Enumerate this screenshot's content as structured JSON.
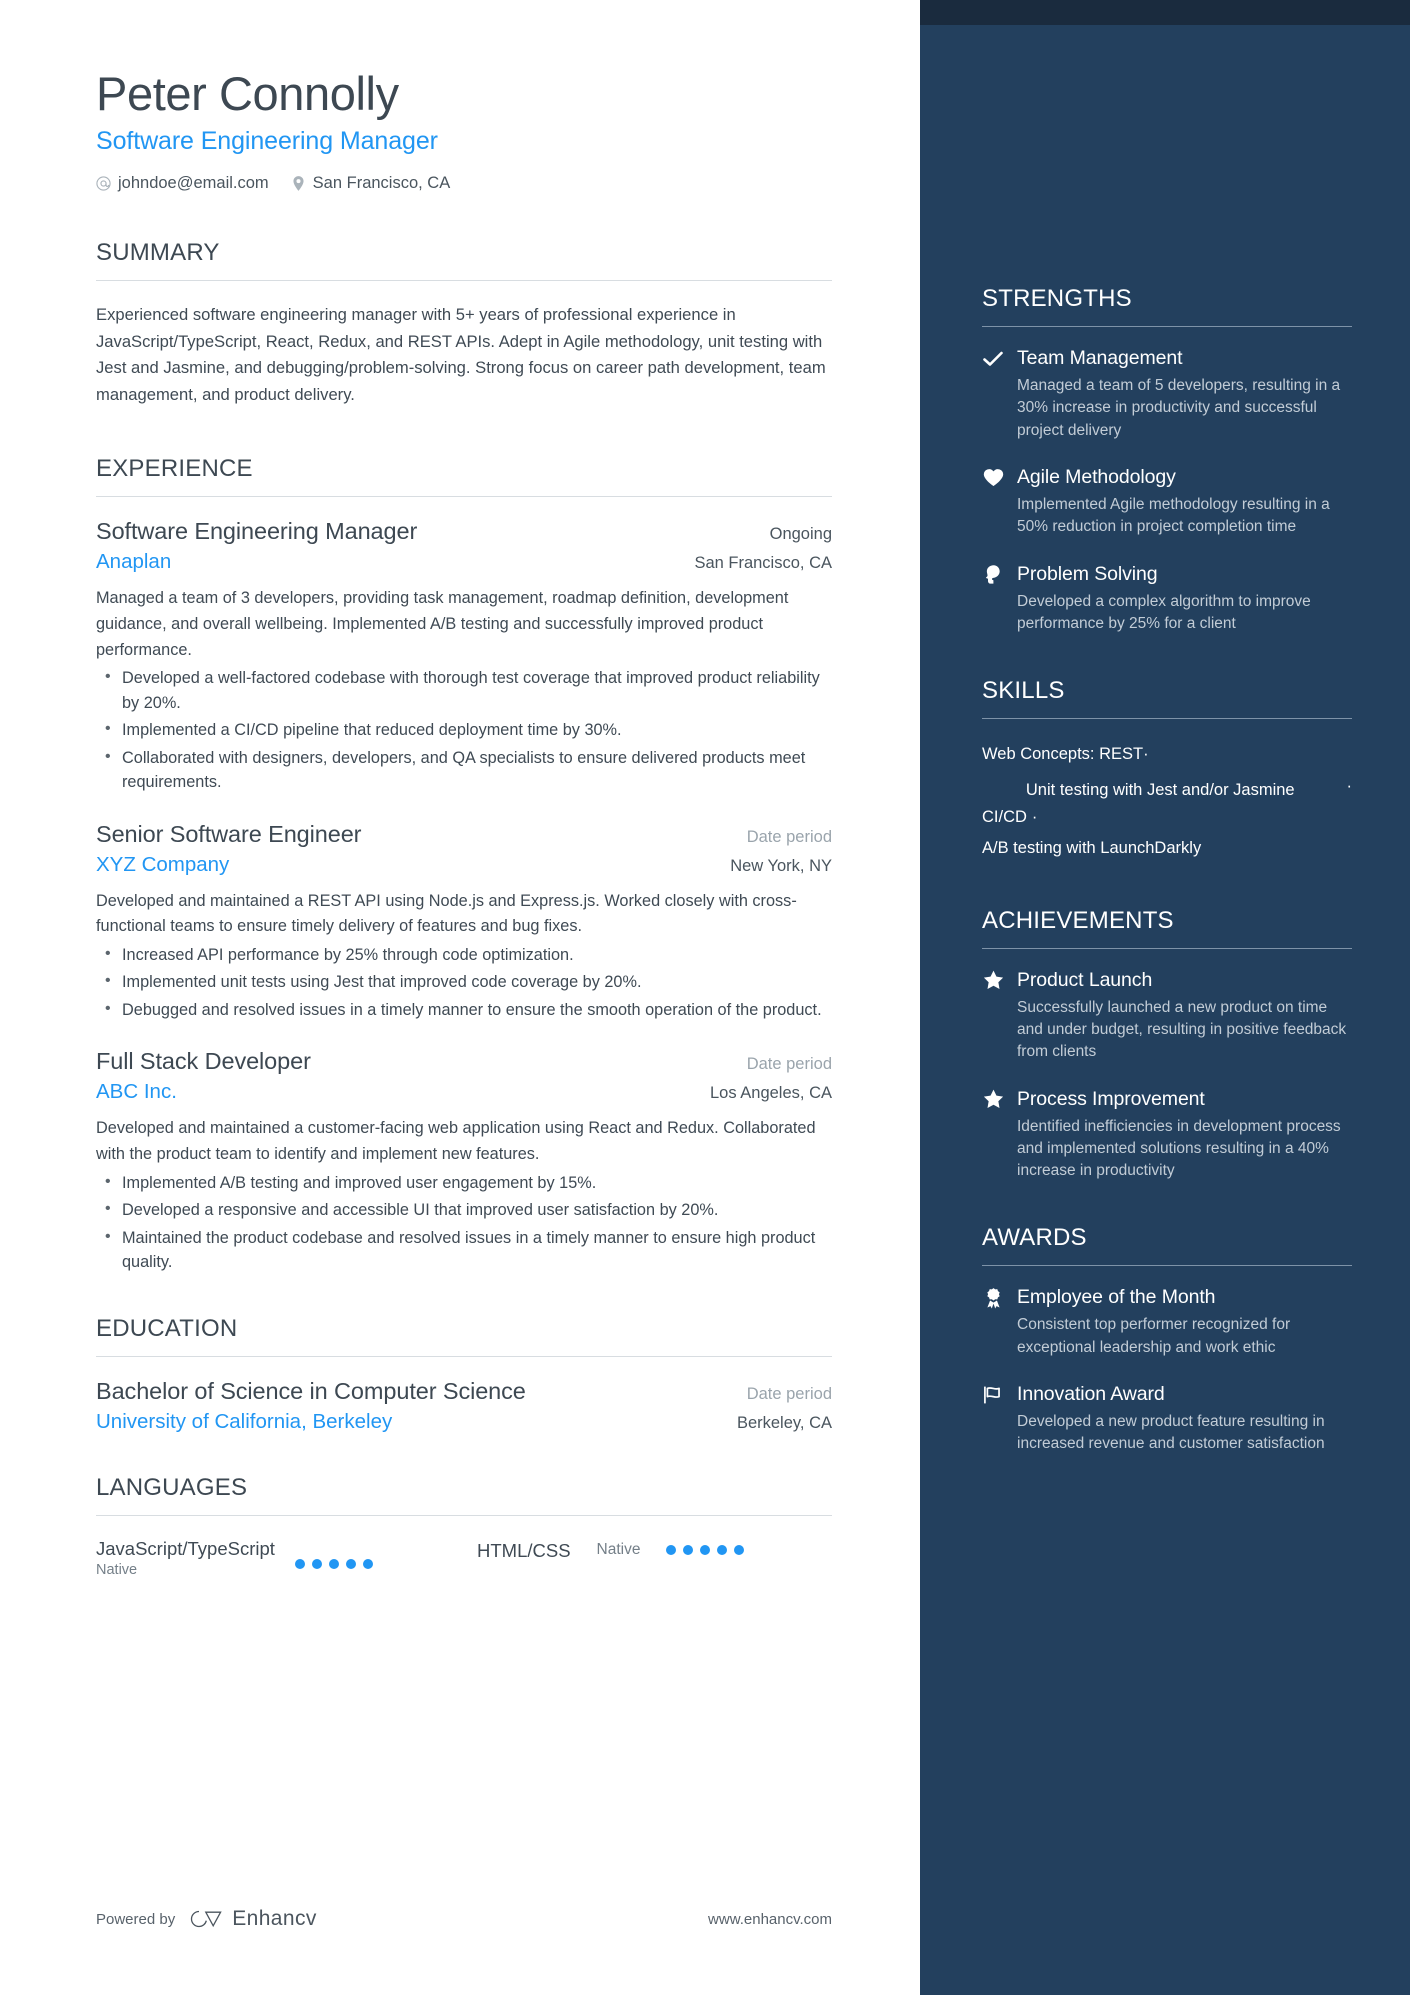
{
  "header": {
    "name": "Peter Connolly",
    "headline": "Software Engineering Manager",
    "email": "johndoe@email.com",
    "location": "San Francisco, CA"
  },
  "summary": {
    "title": "SUMMARY",
    "text": "Experienced software engineering manager with 5+ years of professional experience in JavaScript/TypeScript, React, Redux, and REST APIs. Adept in Agile methodology, unit testing with Jest and Jasmine, and debugging/problem-solving. Strong focus on career path development, team management, and product delivery."
  },
  "experience": {
    "title": "EXPERIENCE",
    "entries": [
      {
        "title": "Software Engineering Manager",
        "date": "Ongoing",
        "org": "Anaplan",
        "location": "San Francisco, CA",
        "description": "Managed a team of 3 developers, providing task management, roadmap definition, development guidance, and overall wellbeing. Implemented A/B testing and successfully improved product performance.",
        "bullets": [
          "Developed a well-factored codebase with thorough test coverage that improved product reliability by 20%.",
          "Implemented a CI/CD pipeline that reduced deployment time by 30%.",
          "Collaborated with designers, developers, and QA specialists to ensure delivered products meet requirements."
        ]
      },
      {
        "title": "Senior Software Engineer",
        "date": "Date period",
        "org": "XYZ Company",
        "location": "New York, NY",
        "description": "Developed and maintained a REST API using Node.js and Express.js. Worked closely with cross-functional teams to ensure timely delivery of features and bug fixes.",
        "bullets": [
          "Increased API performance by 25% through code optimization.",
          "Implemented unit tests using Jest that improved code coverage by 20%.",
          "Debugged and resolved issues in a timely manner to ensure the smooth operation of the product."
        ]
      },
      {
        "title": "Full Stack Developer",
        "date": "Date period",
        "org": "ABC Inc.",
        "location": "Los Angeles, CA",
        "description": "Developed and maintained a customer-facing web application using React and Redux. Collaborated with the product team to identify and implement new features.",
        "bullets": [
          "Implemented A/B testing and improved user engagement by 15%.",
          "Developed a responsive and accessible UI that improved user satisfaction by 20%.",
          "Maintained the product codebase and resolved issues in a timely manner to ensure high product quality."
        ]
      }
    ]
  },
  "education": {
    "title": "EDUCATION",
    "entries": [
      {
        "title": "Bachelor of Science in Computer Science",
        "date": "Date period",
        "org": "University of California, Berkeley",
        "location": "Berkeley, CA"
      }
    ]
  },
  "languages": {
    "title": "LANGUAGES",
    "items": [
      {
        "name": "JavaScript/TypeScript",
        "level": "Native",
        "rating": 5
      },
      {
        "name": "HTML/CSS",
        "level": "Native",
        "rating": 5
      }
    ]
  },
  "footer": {
    "powered_by": "Powered by",
    "brand": "Enhancv",
    "website": "www.enhancv.com"
  },
  "sidebar": {
    "strengths": {
      "title": "STRENGTHS",
      "items": [
        {
          "icon": "check-icon",
          "title": "Team Management",
          "description": "Managed a team of 5 developers, resulting in a 30% increase in productivity and successful project delivery"
        },
        {
          "icon": "heart-icon",
          "title": "Agile Methodology",
          "description": "Implemented Agile methodology resulting in a 50% reduction in project completion time"
        },
        {
          "icon": "head-idea-icon",
          "title": "Problem Solving",
          "description": "Developed a complex algorithm to improve performance by 25% for a client"
        }
      ]
    },
    "skills": {
      "title": "SKILLS",
      "items": [
        "Web Concepts: REST",
        "Unit testing with Jest and/or Jasmine",
        "CI/CD",
        "A/B testing with LaunchDarkly"
      ],
      "separator": "·"
    },
    "achievements": {
      "title": "ACHIEVEMENTS",
      "items": [
        {
          "icon": "star-icon",
          "title": "Product Launch",
          "description": "Successfully launched a new product on time and under budget, resulting in positive feedback from clients"
        },
        {
          "icon": "star-icon",
          "title": "Process Improvement",
          "description": "Identified inefficiencies in development process and implemented solutions resulting in a 40% increase in productivity"
        }
      ]
    },
    "awards": {
      "title": "AWARDS",
      "items": [
        {
          "icon": "award-ribbon-icon",
          "title": "Employee of the Month",
          "description": "Consistent top performer recognized for exceptional leadership and work ethic"
        },
        {
          "icon": "flag-icon",
          "title": "Innovation Award",
          "description": "Developed a new product feature resulting in increased revenue and customer satisfaction"
        }
      ]
    }
  },
  "colors": {
    "accent": "#2196f3",
    "sidebar_bg": "#23405e",
    "sidebar_top_band": "#1a2b3e",
    "heading": "#3d4852",
    "body_text": "#3f4a54"
  }
}
